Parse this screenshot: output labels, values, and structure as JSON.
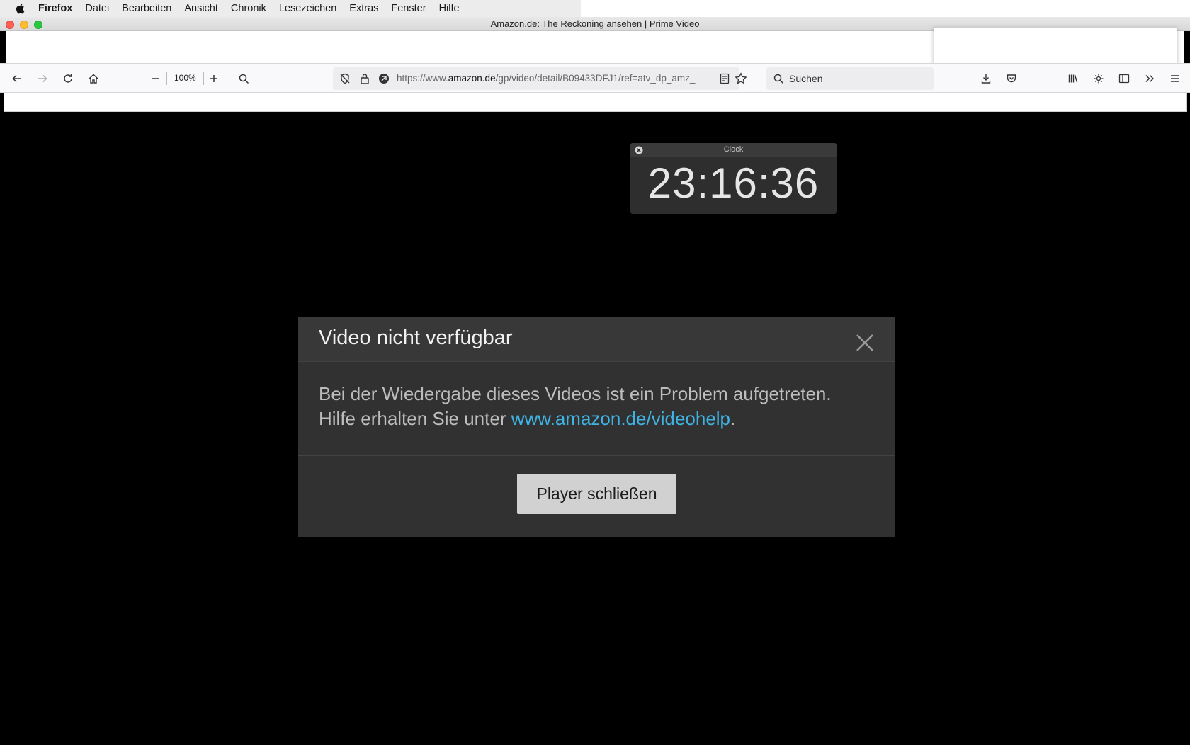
{
  "menubar": {
    "items": [
      "Firefox",
      "Datei",
      "Bearbeiten",
      "Ansicht",
      "Chronik",
      "Lesezeichen",
      "Extras",
      "Fenster",
      "Hilfe"
    ]
  },
  "window": {
    "title": "Amazon.de: The Reckoning ansehen | Prime Video"
  },
  "toolbar": {
    "zoom_level": "100%",
    "url_prefix": "https://www.",
    "url_domain": "amazon.de",
    "url_path": "/gp/video/detail/B09433DFJ1/ref=atv_dp_amz_",
    "search_placeholder": "Suchen"
  },
  "clock": {
    "label": "Clock",
    "time": "23:16:36"
  },
  "dialog": {
    "title": "Video nicht verfügbar",
    "message_line1": "Bei der Wiedergabe dieses Videos ist ein Problem aufgetreten.",
    "message_line2_prefix": "Hilfe erhalten Sie unter ",
    "help_link": "www.amazon.de/videohelp",
    "message_line2_suffix": ".",
    "button_label": "Player schließen"
  },
  "colors": {
    "dialog_background": "#313131",
    "link": "#3fb3e4",
    "button": "#d1d1d1"
  }
}
